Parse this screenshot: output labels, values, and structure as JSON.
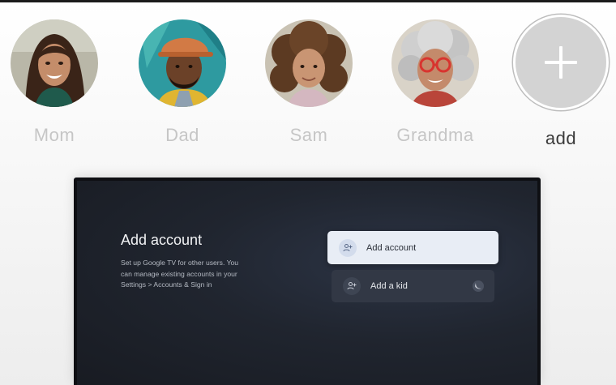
{
  "profiles": [
    {
      "name": "Mom"
    },
    {
      "name": "Dad"
    },
    {
      "name": "Sam"
    },
    {
      "name": "Grandma"
    }
  ],
  "add_profile": {
    "label": "add",
    "icon": "plus-icon"
  },
  "tv_dialog": {
    "title": "Add account",
    "description_lines": [
      "Set up Google TV for other users. You",
      "can manage existing accounts in your",
      "Settings > Accounts & Sign in"
    ],
    "options": [
      {
        "label": "Add account",
        "icon": "person-add-icon",
        "focused": true
      },
      {
        "label": "Add a kid",
        "icon": "person-add-icon",
        "badge": "kid-badge-icon",
        "focused": false
      }
    ]
  },
  "colors": {
    "focus_background": "#e8edf5",
    "screen_background": "#20252f",
    "inactive_name": "#c6c6c6",
    "active_name": "#3a3a3a"
  }
}
